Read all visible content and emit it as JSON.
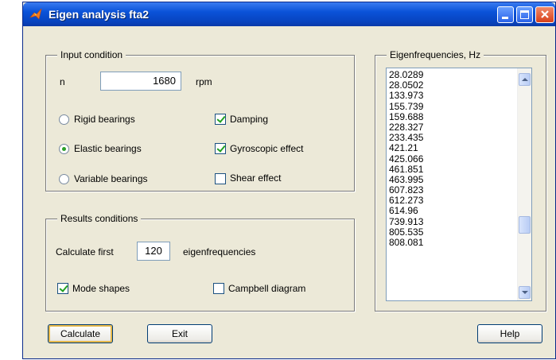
{
  "window": {
    "title": "Eigen analysis fta2"
  },
  "input_condition": {
    "legend": "Input condition",
    "n_label": "n",
    "n_value": "1680",
    "n_unit": "rpm",
    "bearings": [
      {
        "label": "Rigid bearings",
        "selected": false
      },
      {
        "label": "Elastic bearings",
        "selected": true
      },
      {
        "label": "Variable bearings",
        "selected": false
      }
    ],
    "options": [
      {
        "label": "Damping",
        "checked": true
      },
      {
        "label": "Gyroscopic effect",
        "checked": true
      },
      {
        "label": "Shear effect",
        "checked": false
      }
    ]
  },
  "results_conditions": {
    "legend": "Results conditions",
    "calc_first_label": "Calculate first",
    "calc_first_value": "120",
    "calc_first_unit": "eigenfrequencies",
    "mode_shapes_label": "Mode shapes",
    "mode_shapes_checked": true,
    "campbell_label": "Campbell diagram",
    "campbell_checked": false
  },
  "eigenfrequencies": {
    "legend": "Eigenfrequencies, Hz",
    "values": [
      "28.0289",
      "28.0502",
      "133.973",
      "155.739",
      "159.688",
      "228.327",
      "233.435",
      "421.21",
      "425.066",
      "461.851",
      "463.995",
      "607.823",
      "612.273",
      "614.96",
      "739.913",
      "805.535",
      "808.081"
    ]
  },
  "buttons": {
    "calculate": "Calculate",
    "exit": "Exit",
    "help": "Help"
  }
}
